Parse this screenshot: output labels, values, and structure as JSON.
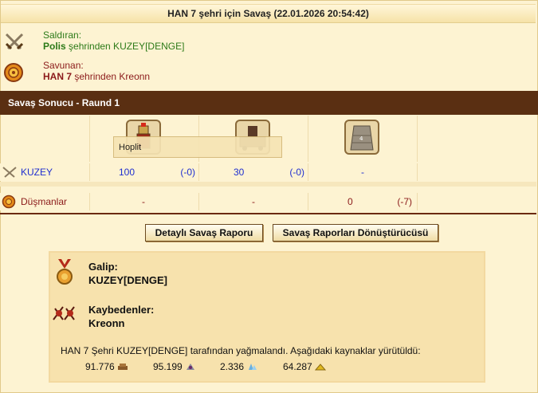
{
  "header": {
    "title": "HAN 7 şehri için Savaş (22.01.2026 20:54:42)"
  },
  "attacker": {
    "role": "Saldıran:",
    "city": "Polis",
    "from_text": " şehrinden KUZEY[DENGE]"
  },
  "defender": {
    "role": "Savunan:",
    "city": "HAN 7",
    "from_text": " şehrinden Kreonn"
  },
  "section": {
    "title": "Savaş Sonucu - Raund 1"
  },
  "tooltip": {
    "text": "Hoplit"
  },
  "rows": {
    "attacker": {
      "name": "KUZEY",
      "c1": "100",
      "c1_loss": "(-0)",
      "c2": "30",
      "c2_loss": "(-0)",
      "c3": "-"
    },
    "defender": {
      "name": "Düşmanlar",
      "c1": "-",
      "c2": "-",
      "c3": "0",
      "c3_loss": "(-7)"
    }
  },
  "buttons": {
    "detail": "Detaylı Savaş Raporu",
    "converter": "Savaş Raporları Dönüştürücüsü"
  },
  "result": {
    "winner_label": "Galip:",
    "winner": "KUZEY[DENGE]",
    "losers_label": "Kaybedenler:",
    "losers": "Kreonn",
    "loot_text": "HAN 7 Şehri KUZEY[DENGE] tarafından yağmalandı. Aşağıdaki kaynaklar yürütüldü:",
    "resources": [
      {
        "value": "91.776",
        "icon": "wood-icon"
      },
      {
        "value": "95.199",
        "icon": "wine-icon"
      },
      {
        "value": "2.336",
        "icon": "crystal-icon"
      },
      {
        "value": "64.287",
        "icon": "sulfur-icon"
      }
    ]
  },
  "colors": {
    "section_bar": "#5a2f12",
    "attacker": "#2c7a18",
    "defender": "#8b1a1a",
    "link": "#1f2fd0"
  }
}
